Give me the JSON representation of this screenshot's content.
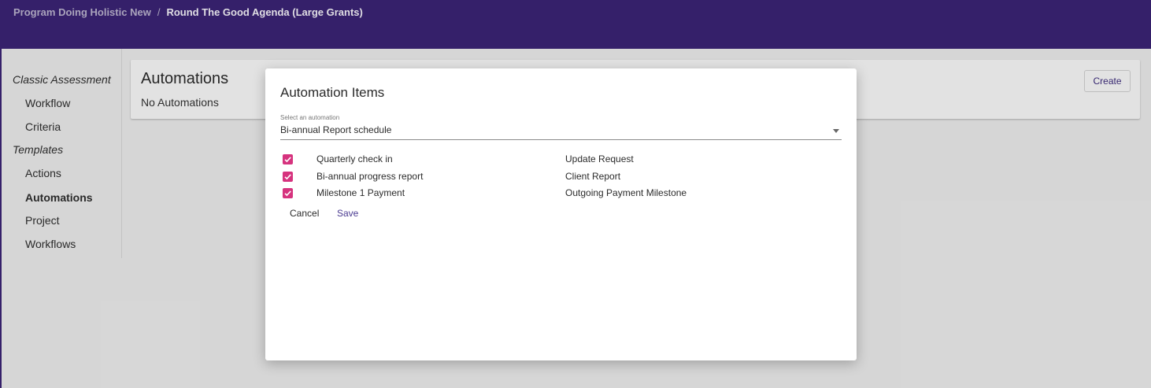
{
  "breadcrumb": {
    "program": "Program Doing Holistic New",
    "separator": "/",
    "round": "Round The Good Agenda (Large Grants)"
  },
  "sidebar": {
    "items": [
      {
        "label": "Classic Assessment",
        "kind": "header"
      },
      {
        "label": "Workflow",
        "kind": "child"
      },
      {
        "label": "Criteria",
        "kind": "child"
      },
      {
        "label": "Templates",
        "kind": "header"
      },
      {
        "label": "Actions",
        "kind": "child"
      },
      {
        "label": "Automations",
        "kind": "child",
        "active": true
      },
      {
        "label": "Project",
        "kind": "child"
      },
      {
        "label": "Workflows",
        "kind": "child"
      }
    ]
  },
  "main": {
    "title": "Automations",
    "empty_text": "No Automations",
    "create_label": "Create"
  },
  "modal": {
    "title": "Automation Items",
    "select_label": "Select an automation",
    "select_value": "Bi-annual Report schedule",
    "items": [
      {
        "name": "Quarterly check in",
        "type": "Update Request",
        "checked": true
      },
      {
        "name": "Bi-annual progress report",
        "type": "Client Report",
        "checked": true
      },
      {
        "name": "Milestone 1 Payment",
        "type": "Outgoing Payment Milestone",
        "checked": true
      }
    ],
    "cancel_label": "Cancel",
    "save_label": "Save"
  },
  "colors": {
    "header_bg": "#3a2374",
    "checkbox": "#d6337e",
    "accent_text": "#4a3a90"
  }
}
